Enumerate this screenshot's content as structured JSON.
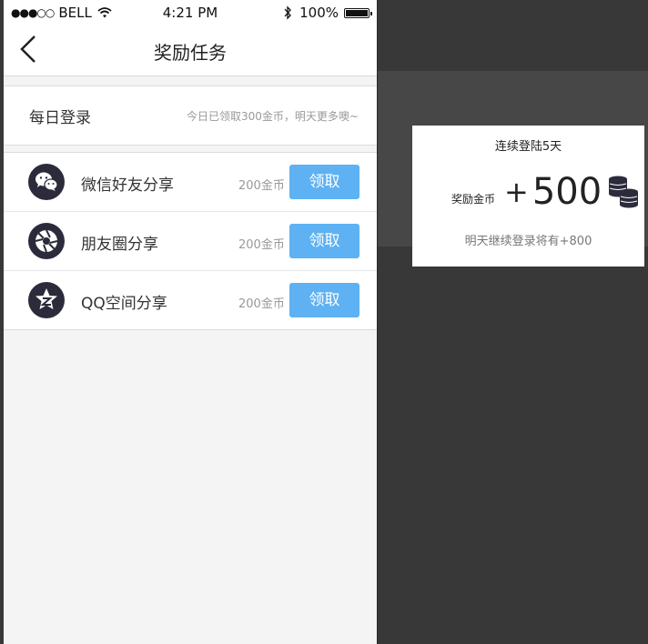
{
  "status_bar": {
    "carrier": "BELL",
    "time": "4:21 PM",
    "battery": "100%"
  },
  "nav": {
    "title": "奖励任务"
  },
  "daily": {
    "label": "每日登录",
    "note": "今日已领取300金币，明天更多噢~"
  },
  "tasks": [
    {
      "name": "微信好友分享",
      "coins": "200金币",
      "button": "领取",
      "icon": "wechat-icon"
    },
    {
      "name": "朋友圈分享",
      "coins": "200金币",
      "button": "领取",
      "icon": "moments-icon"
    },
    {
      "name": "QQ空间分享",
      "coins": "200金币",
      "button": "领取",
      "icon": "qzone-icon"
    }
  ],
  "reward": {
    "title": "连续登陆5天",
    "label": "奖励金币",
    "plus": "+",
    "amount": "500",
    "note": "明天继续登录将有+800",
    "icon": "coin-stack-icon"
  },
  "colors": {
    "accent": "#5eb1f2",
    "icon_bg": "#2b2b3b",
    "backdrop": "#383838"
  }
}
